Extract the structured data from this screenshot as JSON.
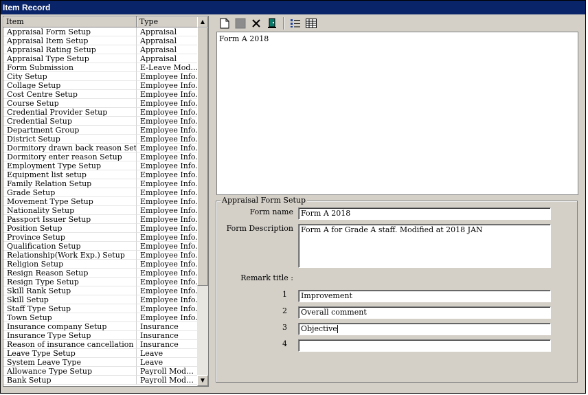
{
  "window": {
    "title": "Item Record"
  },
  "list": {
    "columns": [
      "Item",
      "Type"
    ],
    "rows": [
      [
        "Appraisal Form Setup",
        "Appraisal"
      ],
      [
        "Appraisal Item Setup",
        "Appraisal"
      ],
      [
        "Appraisal Rating Setup",
        "Appraisal"
      ],
      [
        "Appraisal Type Setup",
        "Appraisal"
      ],
      [
        "Form Submission",
        "E-Leave Mod..."
      ],
      [
        "City Setup",
        "Employee Info."
      ],
      [
        "Collage Setup",
        "Employee Info."
      ],
      [
        "Cost Centre Setup",
        "Employee Info."
      ],
      [
        "Course Setup",
        "Employee Info."
      ],
      [
        "Credential Provider Setup",
        "Employee Info."
      ],
      [
        "Credential Setup",
        "Employee Info."
      ],
      [
        "Department Group",
        "Employee Info."
      ],
      [
        "District Setup",
        "Employee Info."
      ],
      [
        "Dormitory drawn back reason Setup",
        "Employee Info."
      ],
      [
        "Dormitory enter reason Setup",
        "Employee Info."
      ],
      [
        "Employment Type Setup",
        "Employee Info."
      ],
      [
        "Equipment list setup",
        "Employee Info."
      ],
      [
        "Family Relation Setup",
        "Employee Info."
      ],
      [
        "Grade Setup",
        "Employee Info."
      ],
      [
        "Movement Type Setup",
        "Employee Info."
      ],
      [
        "Nationality Setup",
        "Employee Info."
      ],
      [
        "Passport Issuer Setup",
        "Employee Info."
      ],
      [
        "Position Setup",
        "Employee Info."
      ],
      [
        "Province Setup",
        "Employee Info."
      ],
      [
        "Qualification Setup",
        "Employee Info."
      ],
      [
        "Relationship(Work Exp.) Setup",
        "Employee Info."
      ],
      [
        "Religion Setup",
        "Employee Info."
      ],
      [
        "Resign Reason Setup",
        "Employee Info."
      ],
      [
        "Resign Type Setup",
        "Employee Info."
      ],
      [
        "Skill Rank Setup",
        "Employee Info."
      ],
      [
        "Skill Setup",
        "Employee Info."
      ],
      [
        "Staff Type Setup",
        "Employee Info."
      ],
      [
        "Town Setup",
        "Employee Info."
      ],
      [
        "Insurance company Setup",
        "Insurance"
      ],
      [
        "Insurance Type Setup",
        "Insurance"
      ],
      [
        "Reason of insurance cancellation Setup",
        "Insurance"
      ],
      [
        "Leave Type Setup",
        "Leave"
      ],
      [
        "System Leave Type",
        "Leave"
      ],
      [
        "Allowance Type Setup",
        "Payroll Module"
      ],
      [
        "Bank Setup",
        "Payroll Module"
      ]
    ]
  },
  "toolbar": {
    "icons": [
      "new-icon",
      "save-icon",
      "delete-icon",
      "exit-icon",
      "list-view-icon",
      "detail-view-icon"
    ]
  },
  "forms": {
    "items": [
      "Form A 2018"
    ]
  },
  "detail": {
    "group_title": "Appraisal Form Setup",
    "form_name_label": "Form name",
    "form_name_value": "Form A 2018",
    "form_desc_label": "Form Description",
    "form_desc_value": "Form A for Grade A staff. Modified at 2018 JAN",
    "remark_label": "Remark title :",
    "remarks": [
      {
        "num": "1",
        "value": "Improvement"
      },
      {
        "num": "2",
        "value": "Overall comment"
      },
      {
        "num": "3",
        "value": "Objective"
      },
      {
        "num": "4",
        "value": ""
      }
    ]
  }
}
